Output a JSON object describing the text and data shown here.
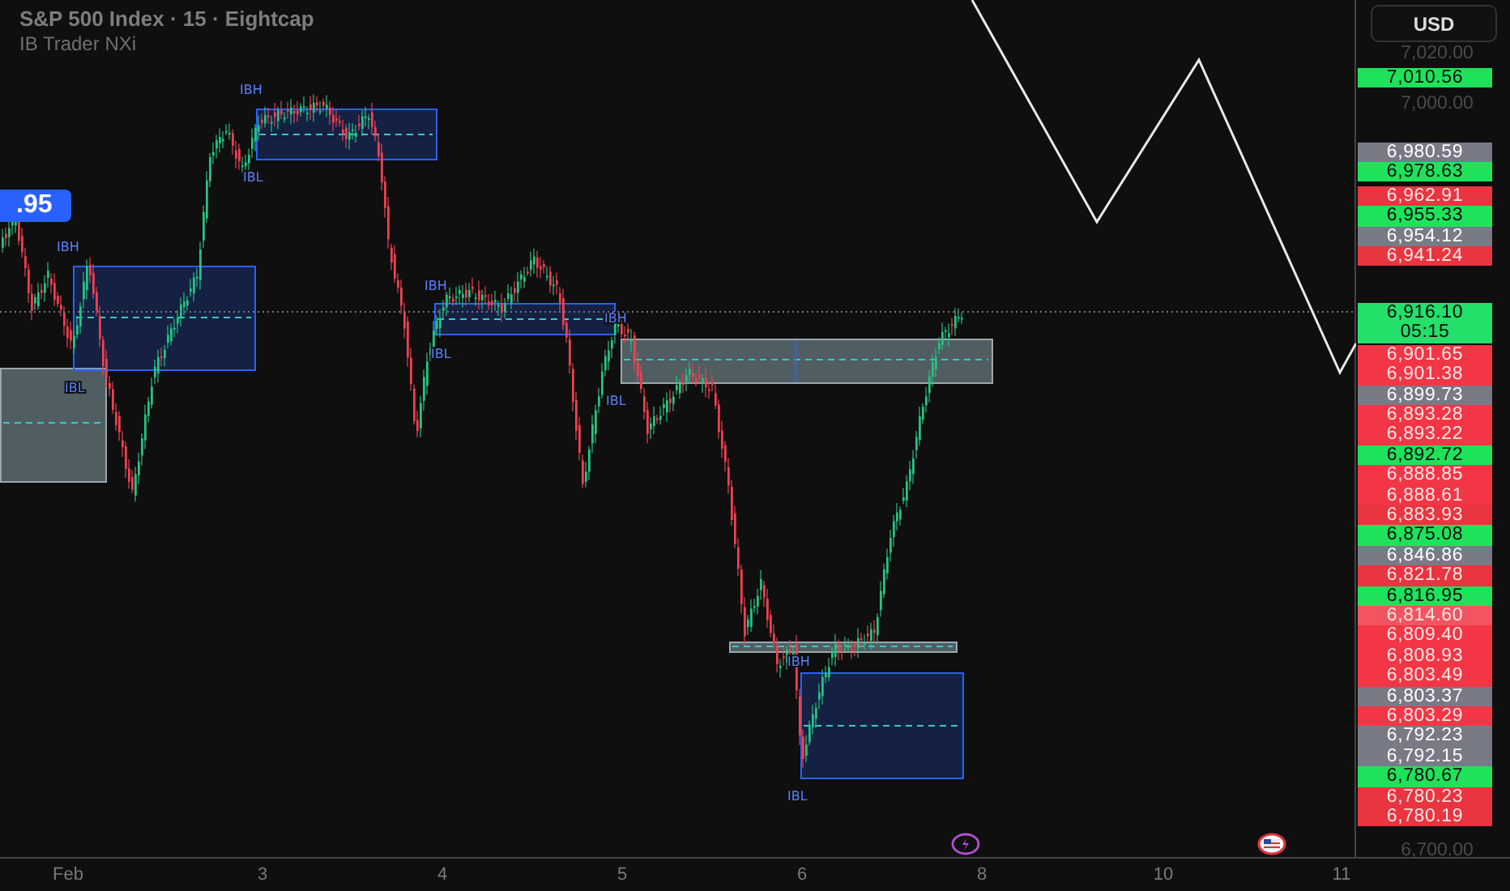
{
  "header": {
    "title": "S&P 500 Index · 15 · Eightcap",
    "indicator": "IB Trader NXi"
  },
  "left_tag": ".95",
  "zones": [
    {
      "kind": "grey"
    },
    {
      "kind": "blue",
      "labels": [
        "IBH",
        "IBL"
      ]
    },
    {
      "kind": "blue",
      "labels": [
        "IBH",
        "IBL"
      ]
    },
    {
      "kind": "blue",
      "labels": [
        "IBH",
        "IBL"
      ]
    },
    {
      "kind": "grey",
      "labels": [
        "IBH",
        "IBL"
      ]
    },
    {
      "kind": "grey",
      "labels": [
        "IBH"
      ]
    },
    {
      "kind": "blue",
      "labels": [
        "IBL"
      ]
    }
  ],
  "price_axis": {
    "currency": "USD",
    "ticks": [
      "7,020.00",
      "7,000.00",
      "6,700.00"
    ],
    "tags": [
      {
        "text": "7,010.56",
        "color": "#1ee35a"
      },
      {
        "text": "6,980.59",
        "color": "#787b86"
      },
      {
        "text": "6,978.63",
        "color": "#1ee35a"
      },
      {
        "text": "6,962.91",
        "color": "#e8353f"
      },
      {
        "text": "6,955.33",
        "color": "#1ee35a"
      },
      {
        "text": "6,954.12",
        "color": "#787b86"
      },
      {
        "text": "6,941.24",
        "color": "#e8353f"
      },
      {
        "text": "6,916.10",
        "color": "#22e06a",
        "countdown": "05:15"
      },
      {
        "text": "6,901.65",
        "color": "#f23645"
      },
      {
        "text": "6,901.38",
        "color": "#f23645"
      },
      {
        "text": "6,899.73",
        "color": "#787b86"
      },
      {
        "text": "6,893.28",
        "color": "#f23645"
      },
      {
        "text": "6,893.22",
        "color": "#f23645"
      },
      {
        "text": "6,892.72",
        "color": "#1ee35a"
      },
      {
        "text": "6,888.85",
        "color": "#f23645"
      },
      {
        "text": "6,888.61",
        "color": "#f23645"
      },
      {
        "text": "6,883.93",
        "color": "#e8353f"
      },
      {
        "text": "6,875.08",
        "color": "#1ee35a"
      },
      {
        "text": "6,846.86",
        "color": "#787b86"
      },
      {
        "text": "6,821.78",
        "color": "#e8353f"
      },
      {
        "text": "6,816.95",
        "color": "#1ee35a"
      },
      {
        "text": "6,814.60",
        "color": "#f25560"
      },
      {
        "text": "6,809.40",
        "color": "#f23645"
      },
      {
        "text": "6,808.93",
        "color": "#f23645"
      },
      {
        "text": "6,803.49",
        "color": "#f23645"
      },
      {
        "text": "6,803.37",
        "color": "#787b86"
      },
      {
        "text": "6,803.29",
        "color": "#f23645"
      },
      {
        "text": "6,792.23",
        "color": "#787b86"
      },
      {
        "text": "6,792.15",
        "color": "#787b86"
      },
      {
        "text": "6,780.67",
        "color": "#1ee35a"
      },
      {
        "text": "6,780.23",
        "color": "#e8353f"
      },
      {
        "text": "6,780.19",
        "color": "#e8353f"
      }
    ]
  },
  "time_axis": {
    "labels": [
      "Feb",
      "3",
      "4",
      "5",
      "6",
      "8",
      "10",
      "11"
    ]
  },
  "events": [
    {
      "kind": "lightning"
    },
    {
      "kind": "flag"
    }
  ]
}
